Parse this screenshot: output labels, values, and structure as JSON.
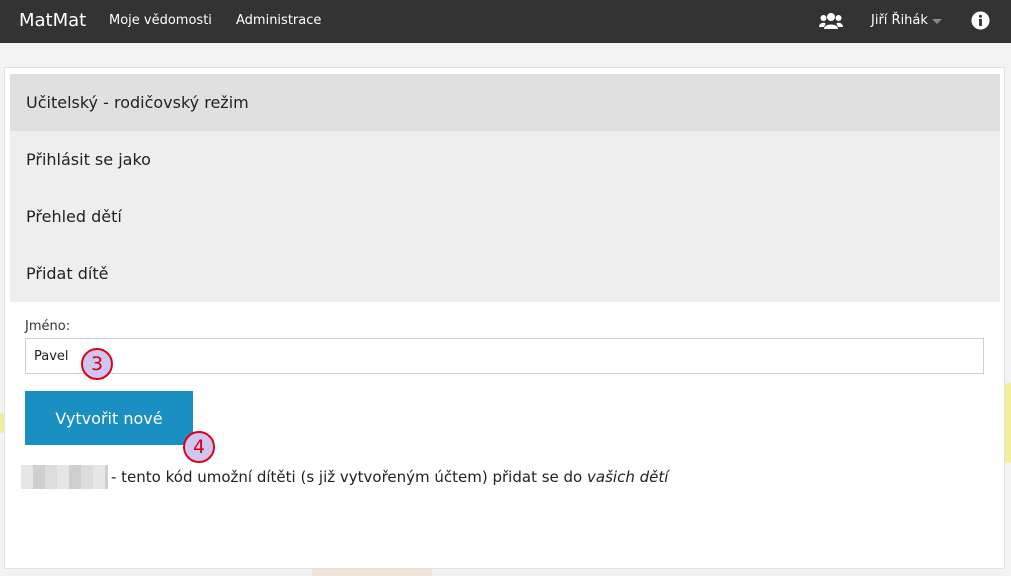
{
  "navbar": {
    "brand": "MatMat",
    "links": [
      "Moje vědomosti",
      "Administrace"
    ],
    "user_name": "Jiří Řihák",
    "icons": {
      "users": "users-icon",
      "info": "info-icon",
      "caret": "caret-down-icon"
    }
  },
  "menu": {
    "items": [
      "Učitelský - rodičovský režim",
      "Přihlásit se jako",
      "Přehled dětí",
      "Přidat dítě"
    ],
    "active_index": 0
  },
  "form": {
    "name_label": "Jméno:",
    "name_value": "Pavel",
    "create_button": "Vytvořit nové"
  },
  "info": {
    "text": "- tento kód umožní dítěti (s již vytvořeným účtem) přidat se do",
    "emphasis": "vašich dětí"
  },
  "callouts": [
    "3",
    "4"
  ],
  "colors": {
    "navbar_bg": "#333333",
    "button_bg": "#1a8fc1",
    "callout_border": "#e0001b",
    "callout_fill": "#cfc6ef"
  }
}
